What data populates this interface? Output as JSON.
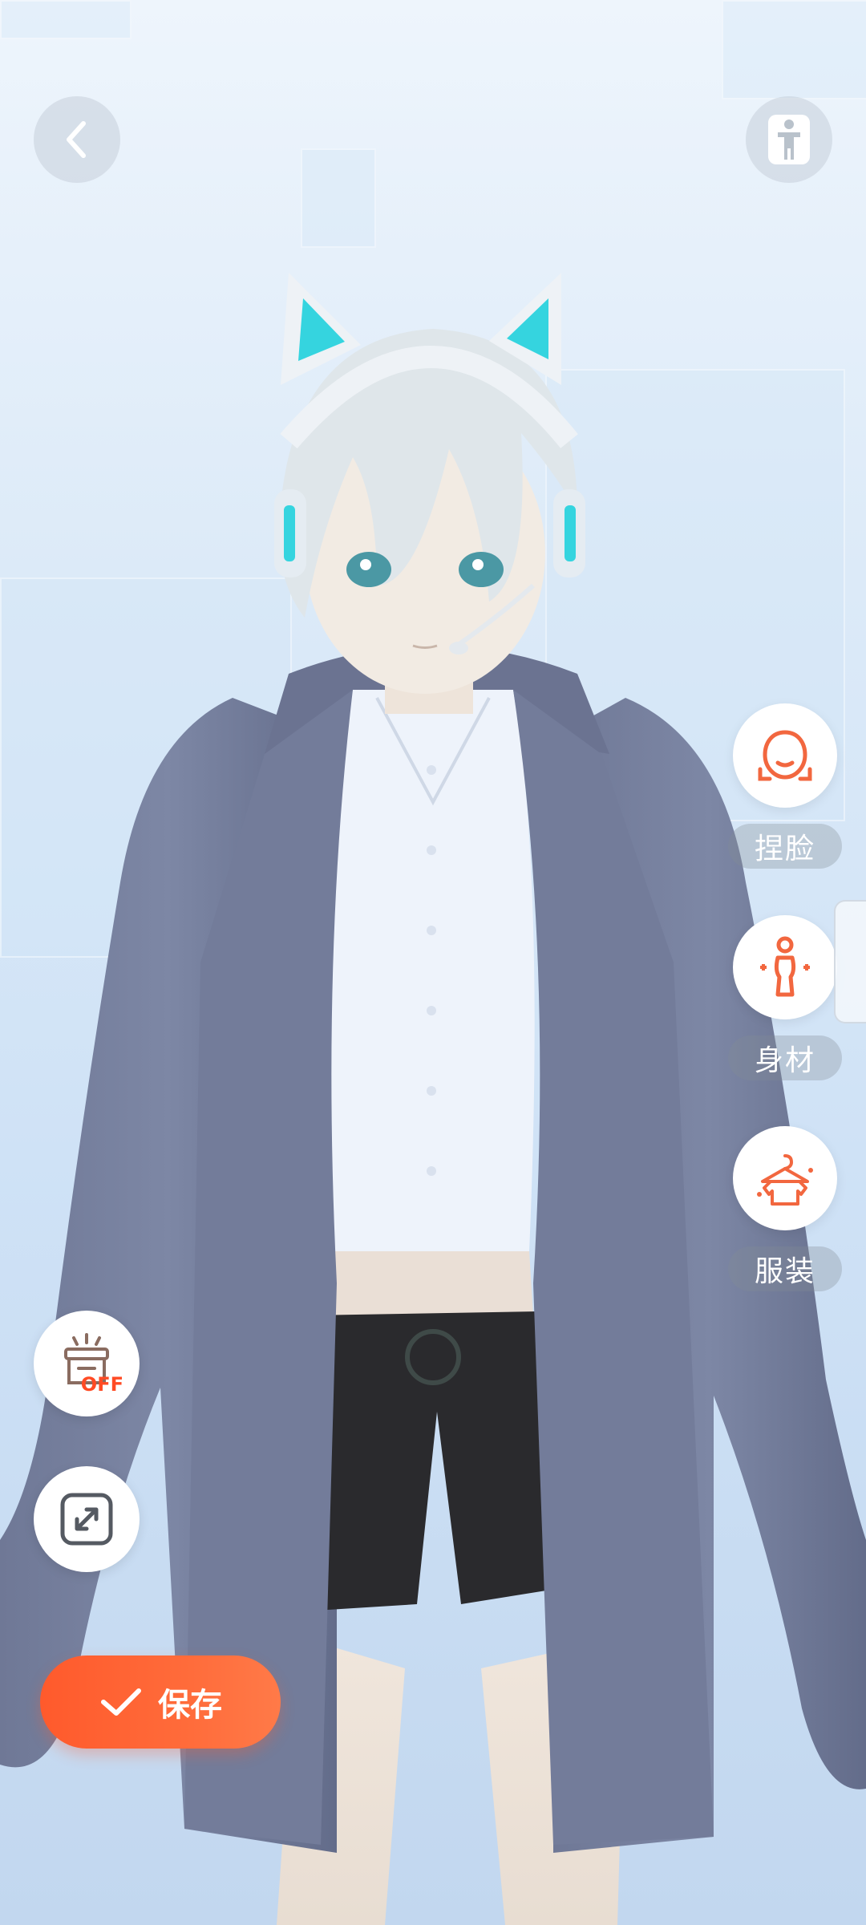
{
  "toolbar": {
    "back_icon": "chevron-left-icon",
    "pose_icon": "standing-figure-icon"
  },
  "right_menu": [
    {
      "key": "face",
      "label": "捏脸",
      "icon": "face-shape-icon"
    },
    {
      "key": "body",
      "label": "身材",
      "icon": "body-shape-icon"
    },
    {
      "key": "outfit",
      "label": "服装",
      "icon": "clothes-hanger-icon"
    }
  ],
  "left_controls": {
    "lighting_toggle": {
      "icon": "stage-light-icon",
      "state_text": "OFF"
    },
    "fullscreen": {
      "icon": "expand-arrows-icon"
    }
  },
  "save_button": {
    "label": "保存",
    "icon": "check-icon"
  },
  "colors": {
    "accent": "#ff5a2c",
    "icon_orange": "#f2673f",
    "background_top": "#eef5fc",
    "background_bottom": "#c2d7ef"
  }
}
